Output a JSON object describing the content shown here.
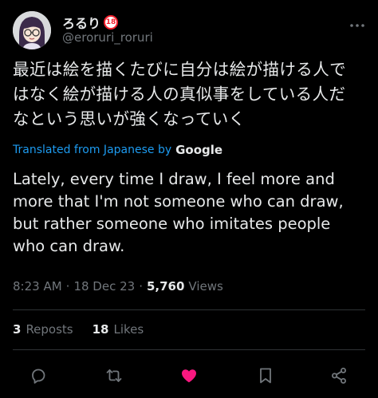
{
  "author": {
    "display_name": "ろるり",
    "age_badge": "18",
    "handle": "@eroruri_roruri"
  },
  "tweet": {
    "original_text": "最近は絵を描くたびに自分は絵が描ける人で\nはなく絵が描ける人の真似事をしている人だ\nなという思いが強くなっていく",
    "translation_label": "Translated from Japanese by",
    "translation_provider": "Google",
    "translated_text": "Lately, every time I draw, I feel more and\nmore that I'm not someone who can draw,\nbut rather someone who imitates people\nwho can draw.",
    "time": "8:23 AM",
    "date": "18 Dec 23",
    "views_count": "5,760",
    "views_label": "Views"
  },
  "stats": {
    "reposts_count": "3",
    "reposts_label": "Reposts",
    "likes_count": "18",
    "likes_label": "Likes"
  },
  "actions": [
    {
      "name": "reply-icon"
    },
    {
      "name": "repost-icon"
    },
    {
      "name": "like-icon",
      "color": "#f91880"
    },
    {
      "name": "bookmark-icon"
    },
    {
      "name": "share-icon"
    }
  ],
  "colors": {
    "background": "#000000",
    "text": "#e7e9ea",
    "muted": "#71767b",
    "link": "#1d9bf0",
    "like": "#f91880",
    "badge": "#f4212e"
  }
}
